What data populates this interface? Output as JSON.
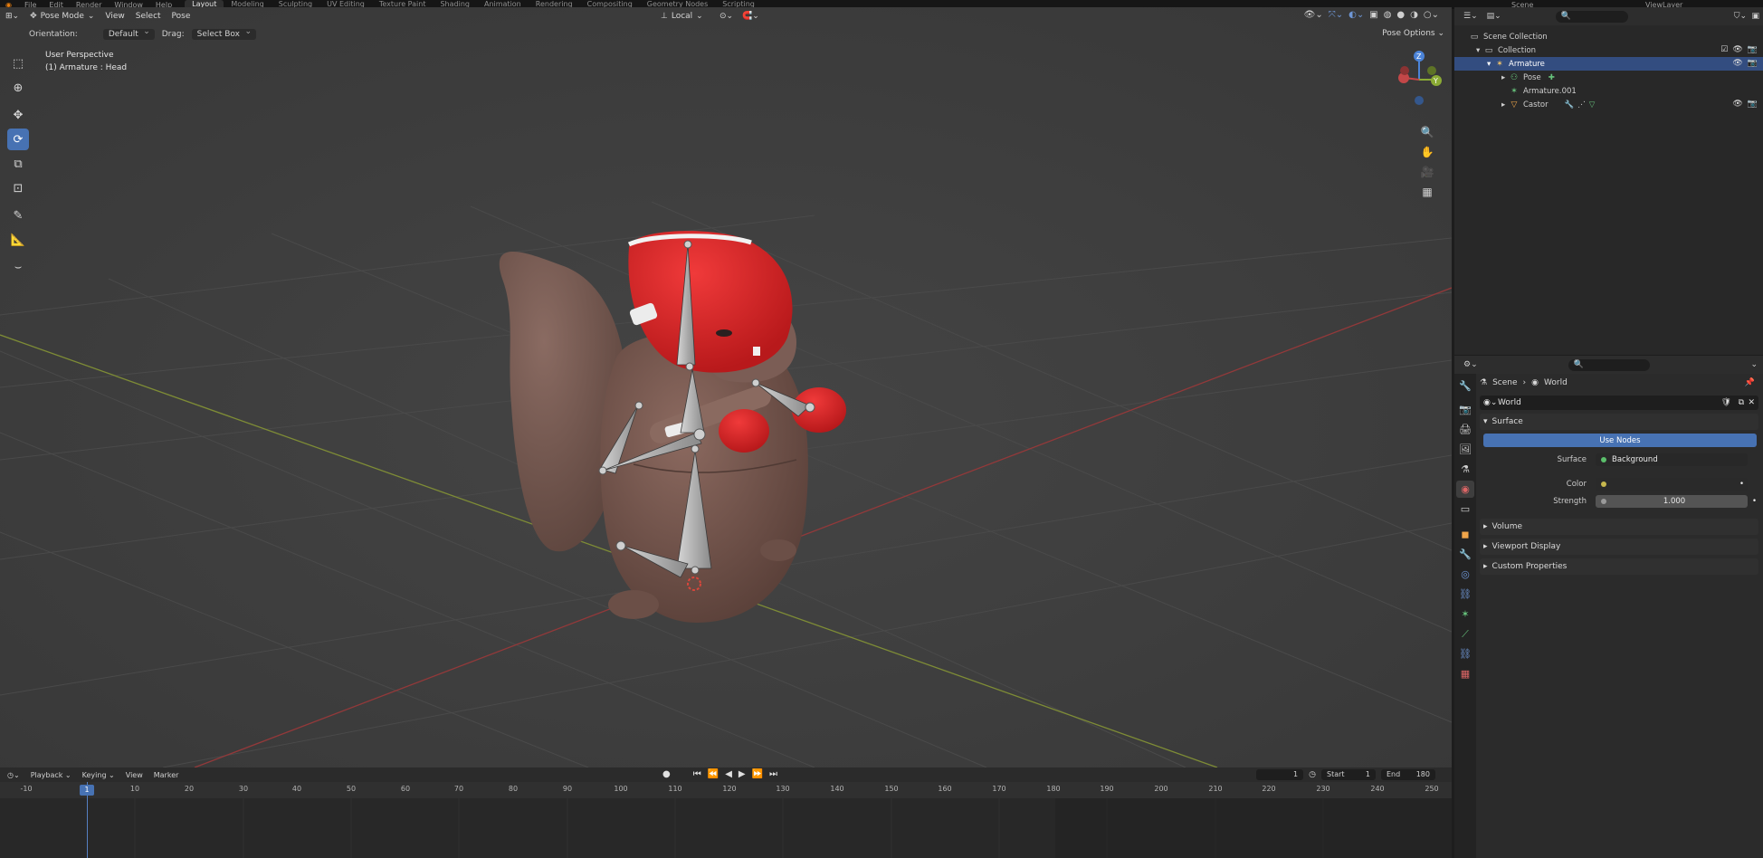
{
  "topbar": {
    "menus": [
      "File",
      "Edit",
      "Render",
      "Window",
      "Help"
    ],
    "workspaces": [
      "Layout",
      "Modeling",
      "Sculpting",
      "UV Editing",
      "Texture Paint",
      "Shading",
      "Animation",
      "Rendering",
      "Compositing",
      "Geometry Nodes",
      "Scripting"
    ],
    "active_workspace": "Layout",
    "scene": "Scene",
    "view_layer": "ViewLayer"
  },
  "viewport": {
    "mode": "Pose Mode",
    "menus": [
      "View",
      "Select",
      "Pose"
    ],
    "orientation_label": "Orientation:",
    "orientation_value": "Default",
    "drag_label": "Drag:",
    "drag_value": "Select Box",
    "transform_space": "Local",
    "pose_options": "Pose Options",
    "view_name": "User Perspective",
    "active_object": "(1) Armature : Head",
    "tools": [
      "select-box",
      "cursor",
      "move",
      "rotate",
      "scale",
      "transform",
      "annotate",
      "measure",
      "relax"
    ],
    "active_tool": "rotate",
    "gizmo": {
      "z": "Z",
      "y": "Y"
    },
    "colors": {
      "x_axis": "#c34748",
      "y_axis": "#8bab35",
      "z_axis": "#4b83d7",
      "active": "#4772b3"
    }
  },
  "timeline": {
    "menus": [
      "Playback",
      "Keying",
      "View",
      "Marker"
    ],
    "current_frame": "1",
    "start_label": "Start",
    "start_value": "1",
    "end_label": "End",
    "end_value": "180",
    "ruler": [
      "-10",
      "1",
      "10",
      "20",
      "30",
      "40",
      "50",
      "60",
      "70",
      "80",
      "90",
      "100",
      "110",
      "120",
      "130",
      "140",
      "150",
      "160",
      "170",
      "180",
      "190",
      "200",
      "210",
      "220",
      "230",
      "240",
      "250"
    ]
  },
  "outliner": {
    "rows": [
      {
        "label": "Scene Collection",
        "depth": 0,
        "icon": "collection-icon"
      },
      {
        "label": "Collection",
        "depth": 1,
        "icon": "collection-icon"
      },
      {
        "label": "Armature",
        "depth": 2,
        "icon": "armature-icon",
        "selected": true
      },
      {
        "label": "Pose",
        "depth": 3,
        "icon": "pose-icon"
      },
      {
        "label": "Armature.001",
        "depth": 3,
        "icon": "armature-data-icon"
      },
      {
        "label": "Castor",
        "depth": 3,
        "icon": "mesh-icon"
      }
    ]
  },
  "properties": {
    "breadcrumb_scene": "Scene",
    "breadcrumb_world": "World",
    "world_name": "World",
    "surface_panel": "Surface",
    "use_nodes": "Use Nodes",
    "surface_label": "Surface",
    "surface_value": "Background",
    "color_label": "Color",
    "strength_label": "Strength",
    "strength_value": "1.000",
    "panels": [
      "Volume",
      "Viewport Display",
      "Custom Properties"
    ]
  }
}
